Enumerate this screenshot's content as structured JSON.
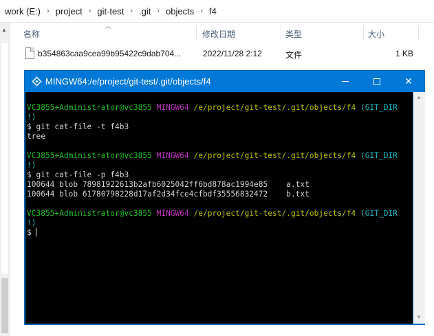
{
  "explorer": {
    "breadcrumb": [
      "work (E:)",
      "project",
      "git-test",
      ".git",
      "objects",
      "f4"
    ],
    "columns": {
      "name": "名称",
      "modified": "修改日期",
      "type": "类型",
      "size": "大小"
    },
    "file": {
      "name": "b354863caa9cea99b95422c9dab704...",
      "modified": "2022/11/28 2:12",
      "type": "文件",
      "size": "1 KB"
    }
  },
  "terminal": {
    "title": "MINGW64:/e/project/git-test/.git/objects/f4",
    "prompt": {
      "user": "VC3855+Administrator@vc3855",
      "system": "MINGW64",
      "path": "/e/project/git-test/.git/objects/f4",
      "branch_start": "(GIT_DIR",
      "branch_end": "!)"
    },
    "commands": {
      "cmd1": "$ git cat-file -t f4b3",
      "out1": "tree",
      "cmd2": "$ git cat-file -p f4b3",
      "out2a": "100644 blob 78981922613b2afb6025042ff6bd878ac1994e85    a.txt",
      "out2b": "100644 blob 61780798228d17af2d34fce4cfbdf35556832472    b.txt",
      "prompt_symbol": "$"
    }
  },
  "colors": {
    "title_bar": "#0078d7",
    "prompt_user": "#1fbf1f",
    "prompt_system": "#c030c0",
    "prompt_path": "#bfbf00",
    "prompt_branch": "#1fb8c8"
  }
}
